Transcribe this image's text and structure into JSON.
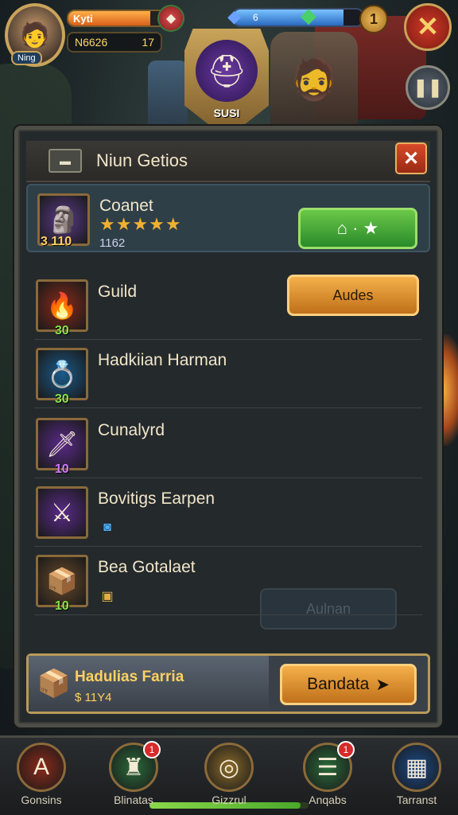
{
  "hud": {
    "player_label": "Kyti",
    "avatar_level": "Ning",
    "orange_bar_fill": 0.78,
    "counter_left": "N6626",
    "counter_right": "17",
    "blue_bar_value": "6",
    "blue_bar_fill": 0.85,
    "coin_count": "1",
    "shield_label": "SUSI"
  },
  "panel": {
    "title": "Niun Getios",
    "close_label": "✕"
  },
  "items": [
    {
      "name": "Coanet",
      "stars": "★★★★★",
      "sub": "1162",
      "badge_num": "3 110",
      "num_color": "#ffd060",
      "icon": "🗿",
      "bg": "#5a3a8a",
      "button": "⌂ · ★",
      "button_type": "green"
    },
    {
      "name": "Guild",
      "badge_num": "30",
      "num_color": "#8ae04a",
      "icon": "🔥",
      "bg": "#8a2a1a",
      "button": "Audes",
      "button_type": "orange"
    },
    {
      "name": "Hadkiian Harman",
      "badge_num": "30",
      "num_color": "#8ae04a",
      "icon": "💍",
      "bg": "#1a5a8a"
    },
    {
      "name": "Cunalyrd",
      "badge_num": "10",
      "num_color": "#d07aff",
      "icon": "🗡",
      "bg": "#5a2a8a"
    },
    {
      "name": "Bovitigs Earpen",
      "icon": "⚔",
      "bg": "#5a2a8a",
      "small_icon": "◙"
    },
    {
      "name": "Bea Gotalaet",
      "badge_num": "10",
      "num_color": "#8ae04a",
      "icon": "📦",
      "bg": "#6a4a2a",
      "small_icon": "▣",
      "button": "Aulnan",
      "button_type": "disabled"
    }
  ],
  "footer": {
    "name": "Hadulias Farria",
    "price": "$ 11Y4",
    "buy_label": "Bandata"
  },
  "nav": [
    {
      "label": "Gonsins",
      "icon": "A",
      "bg": "#8a2a1a"
    },
    {
      "label": "Blinatas",
      "icon": "♜",
      "bg": "#2a6a3a",
      "badge": "1"
    },
    {
      "label": "Gizzrul",
      "icon": "◎",
      "bg": "#8a6a2a"
    },
    {
      "label": "Anqabs",
      "icon": "☰",
      "bg": "#2a6a3a",
      "badge": "1"
    },
    {
      "label": "Tarranst",
      "icon": "▦",
      "bg": "#1a4a8a"
    }
  ],
  "nav_progress": 0.95
}
